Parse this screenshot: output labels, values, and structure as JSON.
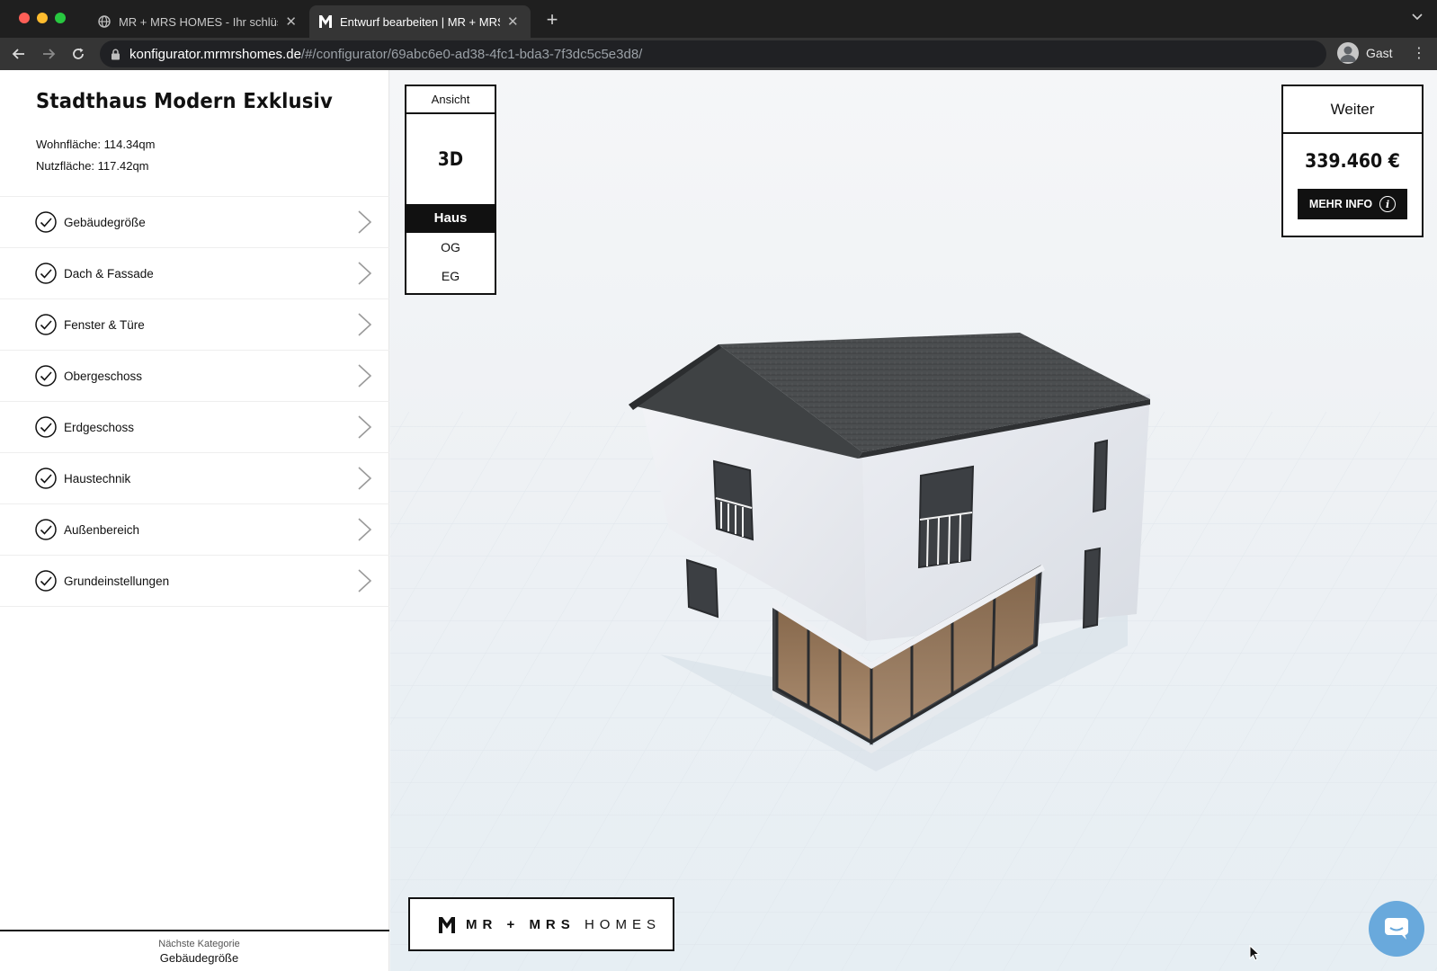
{
  "browser": {
    "tabs": [
      {
        "title": "MR + MRS HOMES - Ihr schlüs",
        "active": false
      },
      {
        "title": "Entwurf bearbeiten | MR + MRS",
        "active": true
      }
    ],
    "url_host": "konfigurator.mrmrshomes.de",
    "url_path": "/#/configurator/69abc6e0-ad38-4fc1-bda3-7f3dc5c5e3d8/",
    "profile_name": "Gast"
  },
  "sidebar": {
    "title": "Stadthaus Modern Exklusiv",
    "wohnflaeche": "Wohnfläche: 114.34qm",
    "nutzflaeche": "Nutzfläche: 117.42qm",
    "items": [
      {
        "label": "Gebäudegröße"
      },
      {
        "label": "Dach & Fassade"
      },
      {
        "label": "Fenster & Türe"
      },
      {
        "label": "Obergeschoss"
      },
      {
        "label": "Erdgeschoss"
      },
      {
        "label": "Haustechnik"
      },
      {
        "label": "Außenbereich"
      },
      {
        "label": "Grundeinstellungen"
      }
    ],
    "next_category_label": "Nächste Kategorie",
    "next_category_value": "Gebäudegröße"
  },
  "view_panel": {
    "header": "Ansicht",
    "mode": "3D",
    "options": [
      "Haus",
      "OG",
      "EG"
    ],
    "active_option": "Haus"
  },
  "price_panel": {
    "next_label": "Weiter",
    "price": "339.460 €",
    "info_label": "MEHR INFO"
  },
  "brand": {
    "part1": "MR",
    "plus": "+",
    "part2": "MRS",
    "part3": "HOMES"
  },
  "colors": {
    "accent_dark": "#111111",
    "chat_blue": "#69a9dc",
    "roof": "#4a4d4f",
    "wall": "#eceef2"
  }
}
